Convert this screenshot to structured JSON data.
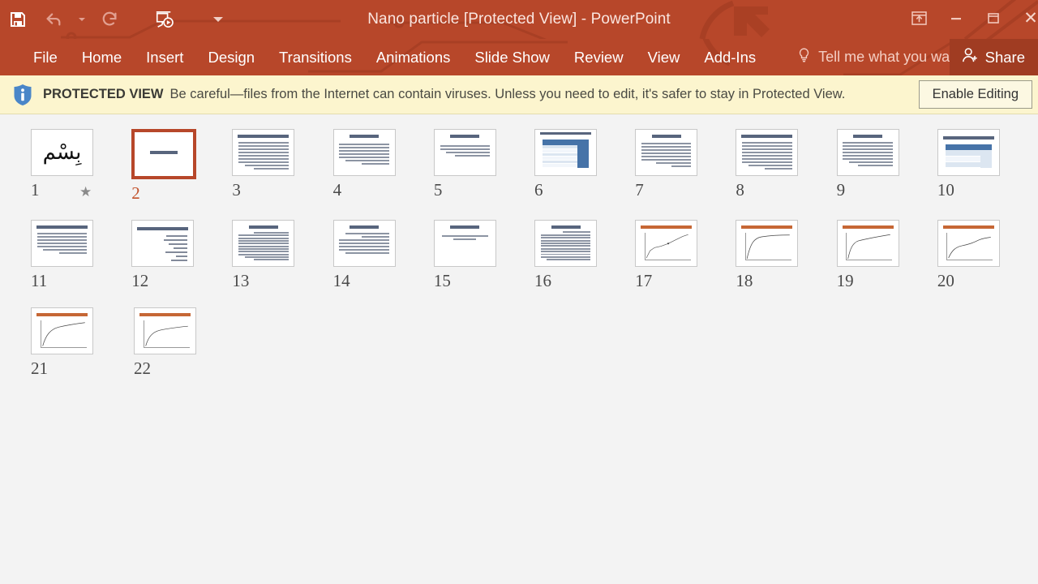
{
  "window": {
    "title": "Nano particle [Protected View] - PowerPoint",
    "theme_color": "#B7472A",
    "share_label": "Share"
  },
  "quick_access": [
    {
      "name": "save-icon",
      "label": "Save",
      "enabled": true
    },
    {
      "name": "undo-icon",
      "label": "Undo",
      "enabled": false
    },
    {
      "name": "undo-dropdown-icon",
      "label": "Undo options",
      "enabled": false
    },
    {
      "name": "redo-icon",
      "label": "Redo",
      "enabled": false
    },
    {
      "name": "start-slideshow-icon",
      "label": "Start From Beginning",
      "enabled": true
    },
    {
      "name": "customize-qat-icon",
      "label": "Customize Quick Access Toolbar",
      "enabled": true
    }
  ],
  "window_controls": [
    {
      "name": "ribbon-display-options-icon",
      "label": "Ribbon Display Options"
    },
    {
      "name": "minimize-icon",
      "label": "Minimize"
    },
    {
      "name": "restore-icon",
      "label": "Restore Down"
    },
    {
      "name": "close-icon",
      "label": "Close"
    }
  ],
  "ribbon": {
    "tabs": [
      {
        "label": "File"
      },
      {
        "label": "Home"
      },
      {
        "label": "Insert"
      },
      {
        "label": "Design"
      },
      {
        "label": "Transitions"
      },
      {
        "label": "Animations"
      },
      {
        "label": "Slide Show"
      },
      {
        "label": "Review"
      },
      {
        "label": "View"
      },
      {
        "label": "Add-Ins"
      }
    ],
    "tell_me": "Tell me what you want to do."
  },
  "protected_view": {
    "badge": "PROTECTED VIEW",
    "message": "Be careful—files from the Internet can contain viruses. Unless you need to edit, it's safer to stay in Protected View.",
    "enable_button": "Enable Editing",
    "background": "#FCF5CE"
  },
  "slides": {
    "selected": 2,
    "count": 22,
    "items": [
      {
        "number": "1",
        "kind": "calligraphy",
        "badge": "star"
      },
      {
        "number": "2",
        "kind": "title-only"
      },
      {
        "number": "3",
        "kind": "title-body"
      },
      {
        "number": "4",
        "kind": "title-body"
      },
      {
        "number": "5",
        "kind": "title-short-body"
      },
      {
        "number": "6",
        "kind": "table-blue"
      },
      {
        "number": "7",
        "kind": "title-body"
      },
      {
        "number": "8",
        "kind": "title-body"
      },
      {
        "number": "9",
        "kind": "title-body"
      },
      {
        "number": "10",
        "kind": "table-light"
      },
      {
        "number": "11",
        "kind": "title-body"
      },
      {
        "number": "12",
        "kind": "title-bullets"
      },
      {
        "number": "13",
        "kind": "title-body-dense"
      },
      {
        "number": "14",
        "kind": "title-body-dense"
      },
      {
        "number": "15",
        "kind": "title-center"
      },
      {
        "number": "16",
        "kind": "title-body-dense"
      },
      {
        "number": "17",
        "kind": "chart-scatter"
      },
      {
        "number": "18",
        "kind": "chart-curve"
      },
      {
        "number": "19",
        "kind": "chart-curve"
      },
      {
        "number": "20",
        "kind": "chart-curve"
      },
      {
        "number": "21",
        "kind": "chart-curve"
      },
      {
        "number": "22",
        "kind": "chart-curve"
      }
    ]
  }
}
